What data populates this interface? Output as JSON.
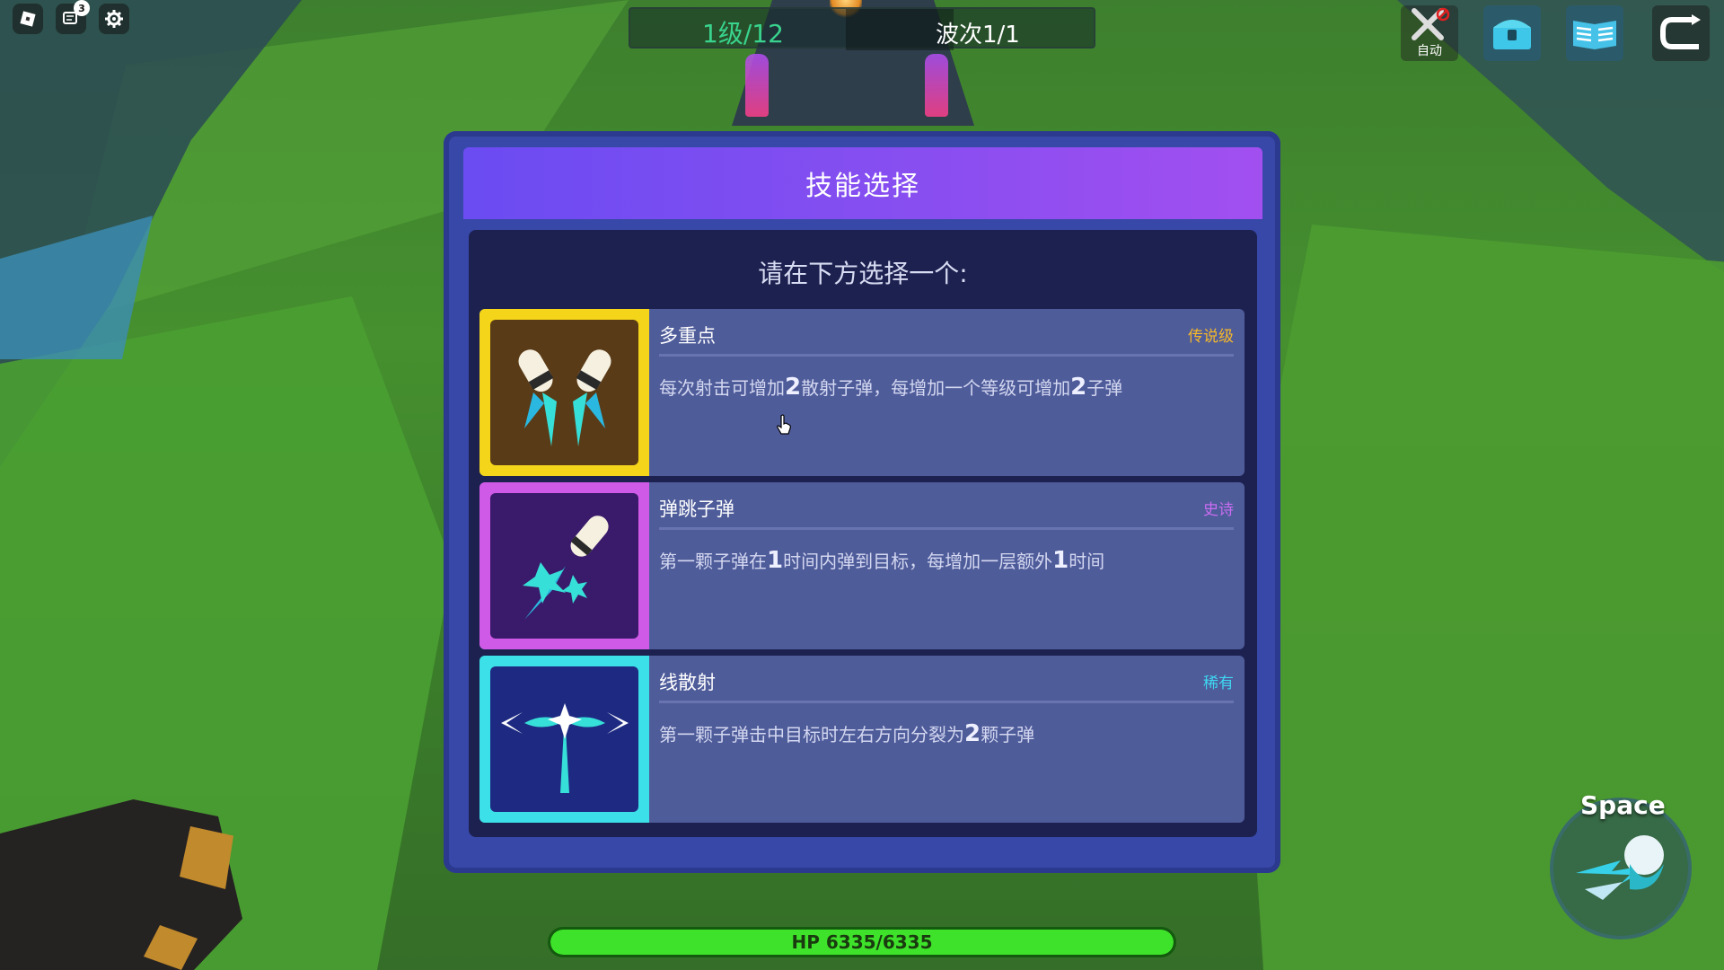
{
  "hud": {
    "level": "1级/12",
    "wave": "波次1/1",
    "chat_badge": "3"
  },
  "top_right": {
    "auto_label": "自动"
  },
  "modal": {
    "title": "技能选择",
    "prompt": "请在下方选择一个:",
    "skills": [
      {
        "name": "多重点",
        "rarity": "传说级",
        "rarity_color": "#f4b82a",
        "icon": "twin-rockets-icon",
        "desc_before": "每次射击可增加",
        "desc_num1": "2",
        "desc_mid": "散射子弹，每增加一个等级可增加",
        "desc_num2": "2",
        "desc_after": "子弹"
      },
      {
        "name": "弹跳子弹",
        "rarity": "史诗",
        "rarity_color": "#c86df0",
        "icon": "bouncing-bullet-icon",
        "desc_before": "第一颗子弹在",
        "desc_num1": "1",
        "desc_mid": "时间内弹到目标，每增加一层额外",
        "desc_num2": "1",
        "desc_after": "时间"
      },
      {
        "name": "线散射",
        "rarity": "稀有",
        "rarity_color": "#3fd6f0",
        "icon": "split-shot-icon",
        "desc_before": "第一颗子弹击中目标时左右方向分裂为",
        "desc_num1": "2",
        "desc_after": "颗子弹"
      }
    ]
  },
  "player": {
    "hp_text": "HP 6335/6335",
    "hp_fraction": 1.0
  },
  "dash": {
    "key_label": "Space"
  }
}
